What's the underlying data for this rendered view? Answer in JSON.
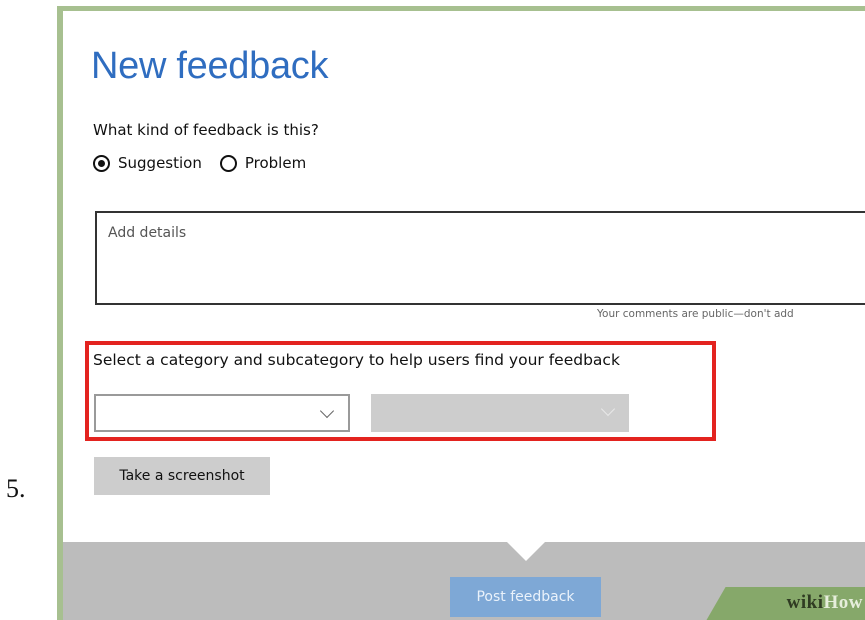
{
  "step": {
    "number": "5."
  },
  "dialog": {
    "title": "New feedback",
    "question": "What kind of feedback is this?",
    "feedback_types": [
      {
        "label": "Suggestion",
        "selected": true
      },
      {
        "label": "Problem",
        "selected": false
      }
    ],
    "details": {
      "placeholder": "Add details",
      "value": ""
    },
    "public_note": "Your comments are public—don't add",
    "category": {
      "label": "Select a category and subcategory to help users find your feedback",
      "primary_value": "",
      "secondary_value": "",
      "secondary_disabled": true
    },
    "screenshot_button": "Take a screenshot",
    "post_button": "Post feedback"
  },
  "watermark": {
    "wiki": "wiki",
    "how": "How"
  },
  "colors": {
    "title": "#2f6dc0",
    "highlight": "#e3231f",
    "post_button": "#7ea8d6",
    "frame": "#a7c090",
    "footer": "#bcbcbc"
  }
}
